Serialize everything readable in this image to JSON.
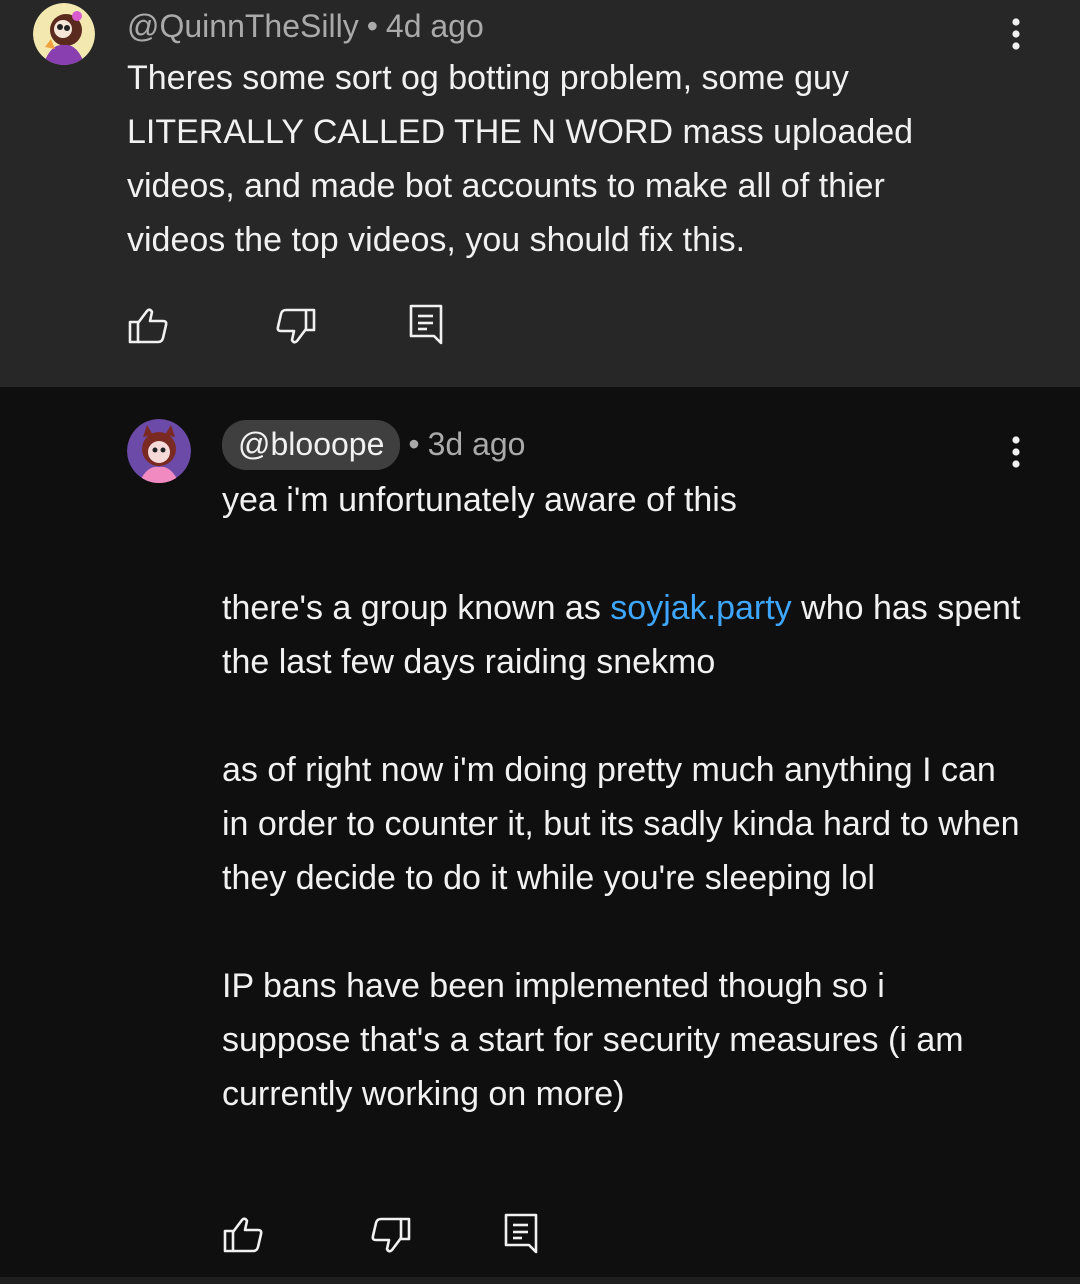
{
  "top_comment": {
    "handle": "@QuinnTheSilly",
    "separator": "•",
    "age": "4d ago",
    "text": "Theres some sort og botting problem, some guy LITERALLY CALLED THE N WORD mass uploaded videos, and made bot accounts to make all of thier videos the top videos, you should fix this.",
    "icons": {
      "like": "thumbs-up-icon",
      "dislike": "thumbs-down-icon",
      "reply": "comment-reply-icon",
      "menu": "more-vertical-icon"
    }
  },
  "reply": {
    "handle": "@blooope",
    "separator": "•",
    "age": "3d ago",
    "paragraphs": {
      "p1": "yea i'm unfortunately aware of this",
      "p2_before_link": "there's a group known as ",
      "p2_link": "soyjak.party",
      "p2_after_link": " who has spent the last few days raiding snekmo",
      "p3": "as of right now i'm doing pretty much anything I can in order to counter it, but its sadly kinda hard to when they decide to do it while you're sleeping lol",
      "p4": "IP bans have been implemented though so i suppose that's a start for security measures (i am currently working on more)"
    },
    "icons": {
      "like": "thumbs-up-icon",
      "dislike": "thumbs-down-icon",
      "reply": "comment-reply-icon",
      "menu": "more-vertical-icon"
    }
  },
  "colors": {
    "top_background": "#272727",
    "page_background": "#0f0f0f",
    "text_primary": "#f1f1f1",
    "text_secondary": "#aaaaaa",
    "link": "#3ea6ff",
    "handle_pill": "#3f3f3f"
  }
}
